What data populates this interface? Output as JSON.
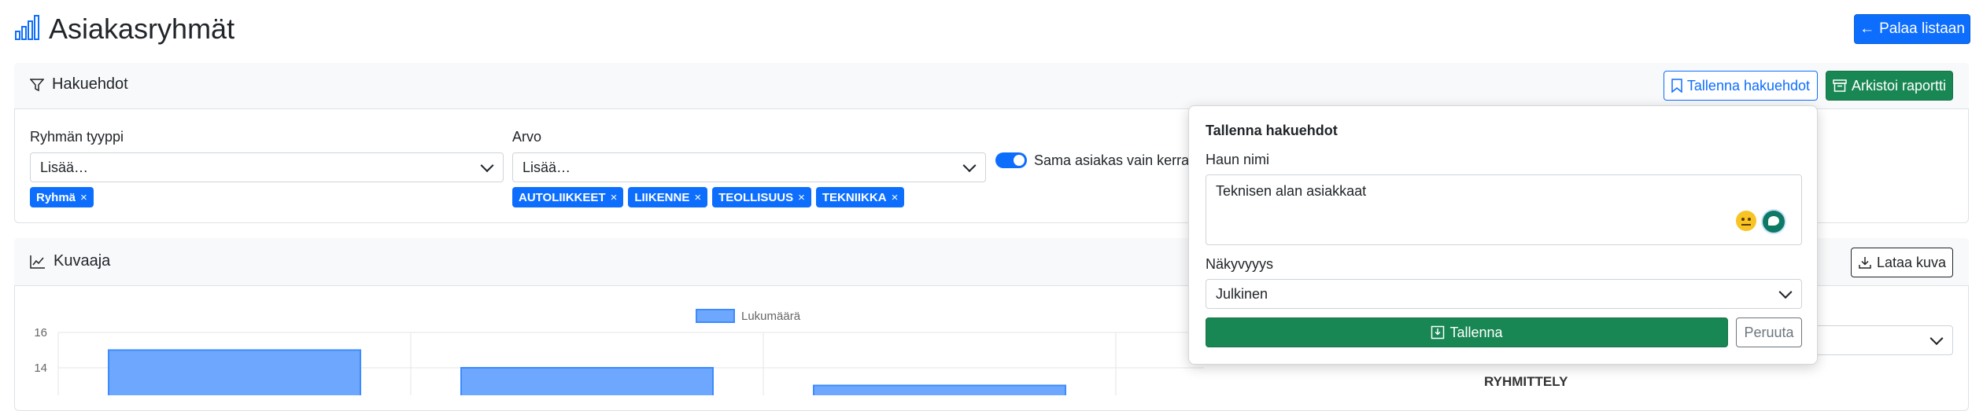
{
  "header": {
    "title": "Asiakasryhmät",
    "back_label": "Palaa listaan"
  },
  "filters": {
    "title": "Hakuehdot",
    "save_search_label": "Tallenna hakuehdot",
    "archive_label": "Arkistoi raportti",
    "group_type": {
      "label": "Ryhmän tyyppi",
      "placeholder": "Lisää…",
      "tags": [
        "Ryhmä"
      ]
    },
    "value": {
      "label": "Arvo",
      "placeholder": "Lisää…",
      "tags": [
        "AUTOLIIKKEET",
        "LIIKENNE",
        "TEOLLISUUS",
        "TEKNIIKKA"
      ]
    },
    "toggle_label": "Sama asiakas vain kerran",
    "toggle_on": true
  },
  "chart_section": {
    "title": "Kuvaaja",
    "download_label": "Lataa kuva",
    "grouping_label": "RYHMITTELY"
  },
  "chart_data": {
    "type": "bar",
    "series": [
      {
        "name": "Lukumäärä",
        "values": [
          15,
          14,
          13
        ]
      }
    ],
    "categories": [
      "",
      "",
      ""
    ],
    "yticks": [
      "16",
      "14"
    ],
    "ylim": [
      12,
      16
    ],
    "grid": true,
    "legend": "top",
    "colors": {
      "fill": "#6ea8fe",
      "stroke": "#3d8bfd"
    }
  },
  "popover": {
    "title": "Tallenna hakuehdot",
    "name_label": "Haun nimi",
    "name_value": "Teknisen alan asiakkaat",
    "visibility_label": "Näkyvyyys",
    "visibility_value": "Julkinen",
    "save_label": "Tallenna",
    "cancel_label": "Peruuta"
  },
  "colors": {
    "primary": "#0d6efd",
    "success": "#198754"
  }
}
